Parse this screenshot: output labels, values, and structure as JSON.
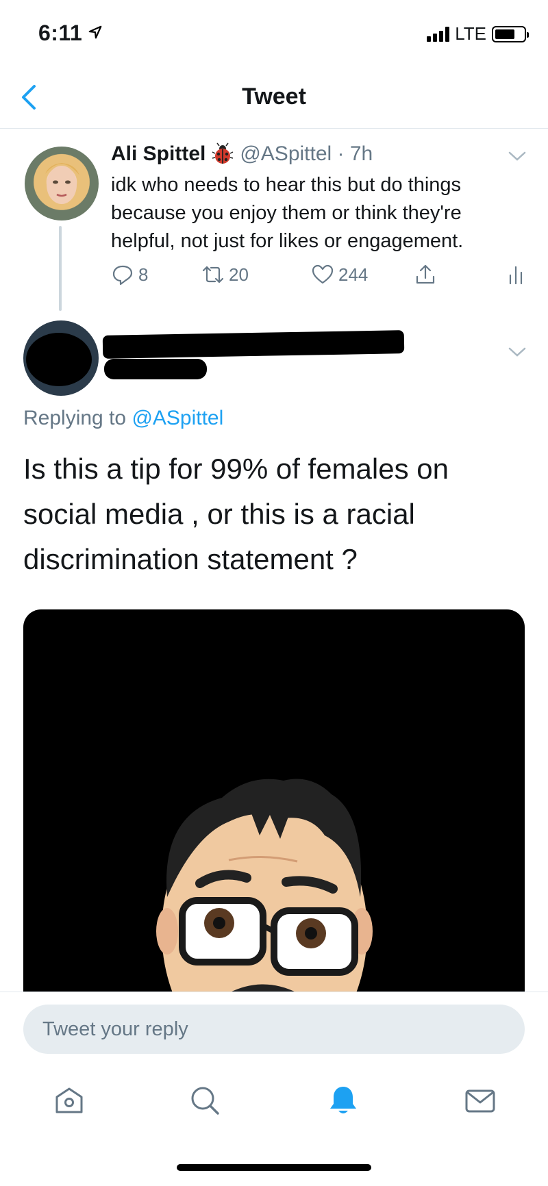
{
  "status_bar": {
    "time": "6:11",
    "network": "LTE",
    "battery_level": 0.7
  },
  "header": {
    "title": "Tweet"
  },
  "original_tweet": {
    "name": "Ali Spittel",
    "badge_icon": "ladybug-emoji",
    "handle_time": "@ASpittel · 7h",
    "text": "idk who needs to hear this but do things because you enjoy them or think they're helpful, not just for likes or engagement.",
    "replies": "8",
    "retweets": "20",
    "likes": "244"
  },
  "reply": {
    "replying_prefix": "Replying to",
    "replying_mention": "@ASpittel",
    "text": "Is this a tip for 99% of females on social media , or this is a racial discrimination statement ?"
  },
  "compose": {
    "placeholder": "Tweet your reply"
  },
  "colors": {
    "accent": "#1da1f2",
    "muted": "#657786",
    "divider": "#e1e8ed",
    "input_bg": "#e6ecf0"
  }
}
